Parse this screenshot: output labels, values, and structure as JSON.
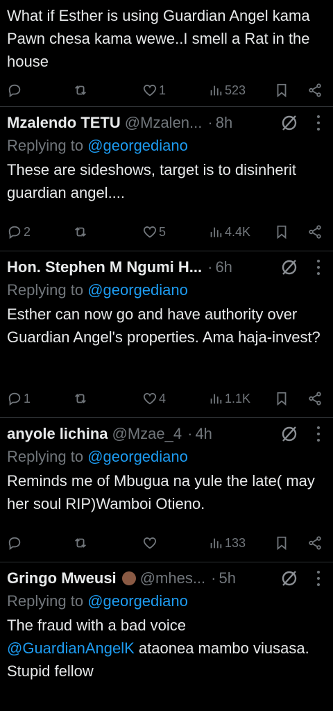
{
  "tweets": [
    {
      "body": "What if Esther is using Guardian Angel kama Pawn chesa kama wewe..I smell a Rat in the house",
      "replies": "",
      "retweets": "",
      "likes": "1",
      "views": "523"
    },
    {
      "name": "Mzalendo TETU",
      "handle": "@Mzalen...",
      "dot": "·",
      "time": "8h",
      "replying_prefix": "Replying to",
      "replying_to": "@georgediano",
      "body": "These are sideshows, target is to disinherit guardian angel....",
      "replies": "2",
      "retweets": "",
      "likes": "5",
      "views": "4.4K"
    },
    {
      "name": "Hon. Stephen M Ngumi H...",
      "handle": "",
      "dot": "·",
      "time": "6h",
      "replying_prefix": "Replying to",
      "replying_to": "@georgediano",
      "body": "Esther can now go and have authority over Guardian Angel's properties. Ama haja-invest?",
      "replies": "1",
      "retweets": "",
      "likes": "4",
      "views": "1.1K"
    },
    {
      "name": "anyole lichina",
      "handle": "@Mzae_4",
      "dot": "·",
      "time": "4h",
      "replying_prefix": "Replying to",
      "replying_to": "@georgediano",
      "body": "Reminds me of Mbugua na yule the late( may her soul RIP)Wamboi Otieno.",
      "replies": "",
      "retweets": "",
      "likes": "",
      "views": "133"
    },
    {
      "name": "Gringo Mweusi",
      "handle": "@mhes...",
      "dot": "·",
      "time": "5h",
      "replying_prefix": "Replying to",
      "replying_to": "@georgediano",
      "body_mention": "@GuardianAngelK",
      "body_pre": "The fraud with a bad voice",
      "body_post": "ataonea mambo viusasa. Stupid fellow"
    }
  ],
  "colors": {
    "background": "#000000",
    "text": "#e7e9ea",
    "muted": "#71767b",
    "link": "#1d9bf0",
    "divider": "#2f3336"
  },
  "icons": [
    "reply-icon",
    "retweet-icon",
    "like-icon",
    "views-icon",
    "bookmark-icon",
    "share-icon",
    "grok-icon",
    "more-icon"
  ]
}
